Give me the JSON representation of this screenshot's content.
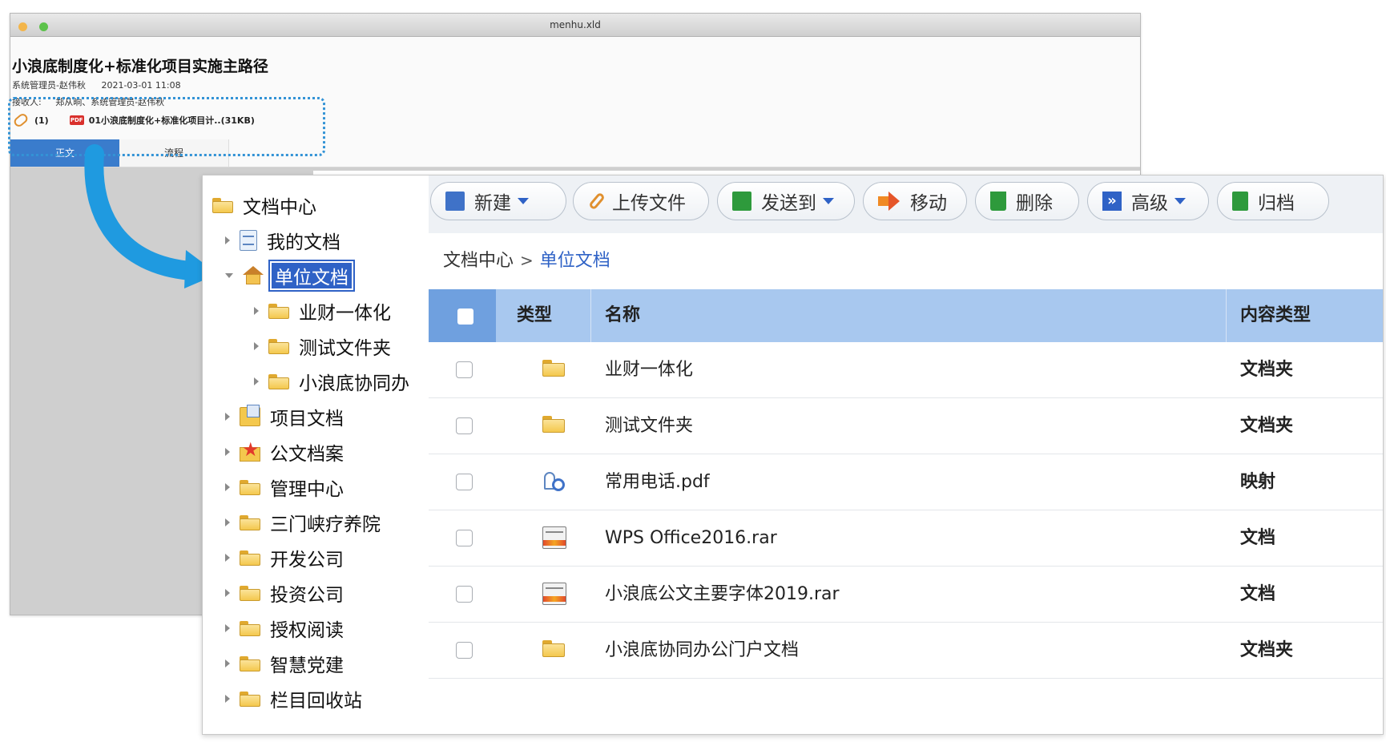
{
  "back_window": {
    "title": "menhu.xld",
    "subject": "小浪底制度化+标准化项目实施主路径",
    "sender": "系统管理员-赵伟秋",
    "date": "2021-03-01 11:08",
    "recipients_label": "接收人:",
    "recipients": "郑从晌、系统管理员-赵伟秋",
    "attachment_count": "(1)",
    "attachment_badge": "PDF",
    "attachment_name": "01小浪底制度化+标准化项目计..(31KB)",
    "tabs": [
      "正文",
      "流程"
    ]
  },
  "tree": {
    "root": "文档中心",
    "items": [
      {
        "label": "我的文档"
      },
      {
        "label": "单位文档"
      },
      {
        "label": "业财一体化"
      },
      {
        "label": "测试文件夹"
      },
      {
        "label": "小浪底协同办"
      },
      {
        "label": "项目文档"
      },
      {
        "label": "公文档案"
      },
      {
        "label": "管理中心"
      },
      {
        "label": "三门峡疗养院"
      },
      {
        "label": "开发公司"
      },
      {
        "label": "投资公司"
      },
      {
        "label": "授权阅读"
      },
      {
        "label": "智慧党建"
      },
      {
        "label": "栏目回收站"
      }
    ]
  },
  "toolbar": {
    "new": "新建",
    "upload": "上传文件",
    "send": "发送到",
    "move": "移动",
    "delete": "删除",
    "advanced": "高级",
    "archive": "归档"
  },
  "breadcrumb": {
    "root": "文档中心",
    "separator": ">",
    "current": "单位文档"
  },
  "table": {
    "headers": {
      "type": "类型",
      "name": "名称",
      "content_type": "内容类型"
    },
    "rows": [
      {
        "icon": "folder-icon",
        "name": "业财一体化",
        "content_type": "文档夹"
      },
      {
        "icon": "folder-icon",
        "name": "测试文件夹",
        "content_type": "文档夹"
      },
      {
        "icon": "map-link-icon",
        "name": "常用电话.pdf",
        "content_type": "映射"
      },
      {
        "icon": "archive-file-icon",
        "name": "WPS Office2016.rar",
        "content_type": "文档"
      },
      {
        "icon": "archive-file-icon",
        "name": "小浪底公文主要字体2019.rar",
        "content_type": "文档"
      },
      {
        "icon": "folder-icon",
        "name": "小浪底协同办公门户文档",
        "content_type": "文档夹"
      }
    ]
  },
  "colors": {
    "accent": "#2f62c6",
    "table_header": "#a8c8ef",
    "arrow": "#1f9ae0",
    "highlight": "#3393d6"
  }
}
